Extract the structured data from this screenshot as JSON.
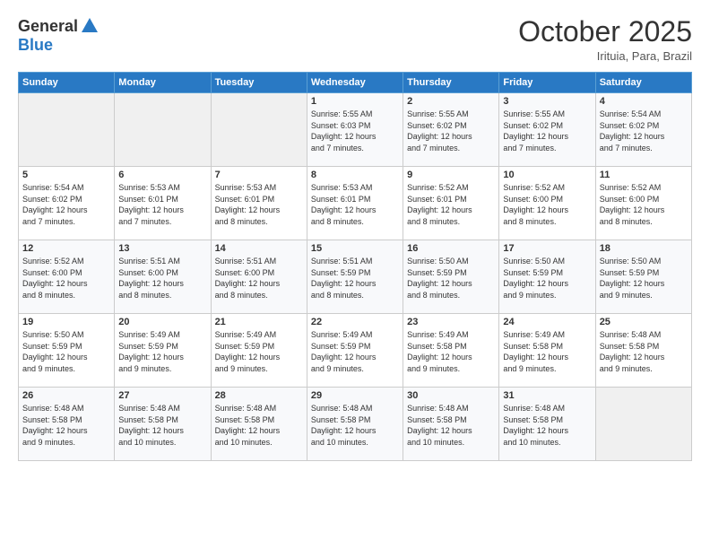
{
  "header": {
    "logo_general": "General",
    "logo_blue": "Blue",
    "month_title": "October 2025",
    "subtitle": "Irituia, Para, Brazil"
  },
  "days_of_week": [
    "Sunday",
    "Monday",
    "Tuesday",
    "Wednesday",
    "Thursday",
    "Friday",
    "Saturday"
  ],
  "weeks": [
    [
      {
        "day": "",
        "info": ""
      },
      {
        "day": "",
        "info": ""
      },
      {
        "day": "",
        "info": ""
      },
      {
        "day": "1",
        "info": "Sunrise: 5:55 AM\nSunset: 6:03 PM\nDaylight: 12 hours\nand 7 minutes."
      },
      {
        "day": "2",
        "info": "Sunrise: 5:55 AM\nSunset: 6:02 PM\nDaylight: 12 hours\nand 7 minutes."
      },
      {
        "day": "3",
        "info": "Sunrise: 5:55 AM\nSunset: 6:02 PM\nDaylight: 12 hours\nand 7 minutes."
      },
      {
        "day": "4",
        "info": "Sunrise: 5:54 AM\nSunset: 6:02 PM\nDaylight: 12 hours\nand 7 minutes."
      }
    ],
    [
      {
        "day": "5",
        "info": "Sunrise: 5:54 AM\nSunset: 6:02 PM\nDaylight: 12 hours\nand 7 minutes."
      },
      {
        "day": "6",
        "info": "Sunrise: 5:53 AM\nSunset: 6:01 PM\nDaylight: 12 hours\nand 7 minutes."
      },
      {
        "day": "7",
        "info": "Sunrise: 5:53 AM\nSunset: 6:01 PM\nDaylight: 12 hours\nand 8 minutes."
      },
      {
        "day": "8",
        "info": "Sunrise: 5:53 AM\nSunset: 6:01 PM\nDaylight: 12 hours\nand 8 minutes."
      },
      {
        "day": "9",
        "info": "Sunrise: 5:52 AM\nSunset: 6:01 PM\nDaylight: 12 hours\nand 8 minutes."
      },
      {
        "day": "10",
        "info": "Sunrise: 5:52 AM\nSunset: 6:00 PM\nDaylight: 12 hours\nand 8 minutes."
      },
      {
        "day": "11",
        "info": "Sunrise: 5:52 AM\nSunset: 6:00 PM\nDaylight: 12 hours\nand 8 minutes."
      }
    ],
    [
      {
        "day": "12",
        "info": "Sunrise: 5:52 AM\nSunset: 6:00 PM\nDaylight: 12 hours\nand 8 minutes."
      },
      {
        "day": "13",
        "info": "Sunrise: 5:51 AM\nSunset: 6:00 PM\nDaylight: 12 hours\nand 8 minutes."
      },
      {
        "day": "14",
        "info": "Sunrise: 5:51 AM\nSunset: 6:00 PM\nDaylight: 12 hours\nand 8 minutes."
      },
      {
        "day": "15",
        "info": "Sunrise: 5:51 AM\nSunset: 5:59 PM\nDaylight: 12 hours\nand 8 minutes."
      },
      {
        "day": "16",
        "info": "Sunrise: 5:50 AM\nSunset: 5:59 PM\nDaylight: 12 hours\nand 8 minutes."
      },
      {
        "day": "17",
        "info": "Sunrise: 5:50 AM\nSunset: 5:59 PM\nDaylight: 12 hours\nand 9 minutes."
      },
      {
        "day": "18",
        "info": "Sunrise: 5:50 AM\nSunset: 5:59 PM\nDaylight: 12 hours\nand 9 minutes."
      }
    ],
    [
      {
        "day": "19",
        "info": "Sunrise: 5:50 AM\nSunset: 5:59 PM\nDaylight: 12 hours\nand 9 minutes."
      },
      {
        "day": "20",
        "info": "Sunrise: 5:49 AM\nSunset: 5:59 PM\nDaylight: 12 hours\nand 9 minutes."
      },
      {
        "day": "21",
        "info": "Sunrise: 5:49 AM\nSunset: 5:59 PM\nDaylight: 12 hours\nand 9 minutes."
      },
      {
        "day": "22",
        "info": "Sunrise: 5:49 AM\nSunset: 5:59 PM\nDaylight: 12 hours\nand 9 minutes."
      },
      {
        "day": "23",
        "info": "Sunrise: 5:49 AM\nSunset: 5:58 PM\nDaylight: 12 hours\nand 9 minutes."
      },
      {
        "day": "24",
        "info": "Sunrise: 5:49 AM\nSunset: 5:58 PM\nDaylight: 12 hours\nand 9 minutes."
      },
      {
        "day": "25",
        "info": "Sunrise: 5:48 AM\nSunset: 5:58 PM\nDaylight: 12 hours\nand 9 minutes."
      }
    ],
    [
      {
        "day": "26",
        "info": "Sunrise: 5:48 AM\nSunset: 5:58 PM\nDaylight: 12 hours\nand 9 minutes."
      },
      {
        "day": "27",
        "info": "Sunrise: 5:48 AM\nSunset: 5:58 PM\nDaylight: 12 hours\nand 10 minutes."
      },
      {
        "day": "28",
        "info": "Sunrise: 5:48 AM\nSunset: 5:58 PM\nDaylight: 12 hours\nand 10 minutes."
      },
      {
        "day": "29",
        "info": "Sunrise: 5:48 AM\nSunset: 5:58 PM\nDaylight: 12 hours\nand 10 minutes."
      },
      {
        "day": "30",
        "info": "Sunrise: 5:48 AM\nSunset: 5:58 PM\nDaylight: 12 hours\nand 10 minutes."
      },
      {
        "day": "31",
        "info": "Sunrise: 5:48 AM\nSunset: 5:58 PM\nDaylight: 12 hours\nand 10 minutes."
      },
      {
        "day": "",
        "info": ""
      }
    ]
  ]
}
